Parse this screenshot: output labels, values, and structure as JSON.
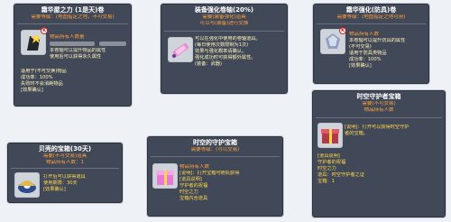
{
  "cards": [
    {
      "title": "霜华屋之力 (1是天)卷",
      "sub1": "需要等级：(地图指定之地，不可交易)",
      "sub2": "物品持有人数量",
      "lines": [
        "本卷轴可以提升物品的属性",
        "使用后可以获得永久属性",
        "适用于(不可交换)物品",
        "成功率：100%",
        "失败时不会消耗物品",
        "[效果确认]"
      ],
      "icon": "star-stone-icon",
      "badge": "K"
    },
    {
      "title": "装备强化卷轴(20%)",
      "sub1": "需要(装备强化)道具",
      "sub2": "可以与(装备)进行交换",
      "lines": [
        "可以在强化中使用的卷轴道具。",
        "(每日使用次数限制为1次)",
        "效果与强化概率请确认。",
        "强化成功时可获得额外属性。",
        "(装备：武器)"
      ],
      "icon": "scroll-icon"
    },
    {
      "title": "霜华强化(防具)卷",
      "sub1": "需要等级：(地图指定之地可用)",
      "sub2": "物品持有人数",
      "lines": [
        "本卷轴可以提升防具的属性",
        "(不可交易)",
        "适用于防具类物品",
        "成功率：100%",
        "[效果确认]"
      ],
      "icon": "crystal-armor-icon",
      "badge": "K"
    },
    {
      "title": "贝壳的宝箱(30天)",
      "sub1": "需要(不可交易)道具",
      "sub2": "物品持有人数：1",
      "lines": [
        "打开后可以获得道具",
        "使用期限：30天",
        "[效果确认]"
      ],
      "icon": "shell-pearl-icon"
    },
    {
      "title": "时空的守护宝箱",
      "sub1": "需要等级：(可以交易)",
      "sub2": "物品持有人数",
      "lines": [
        "[说明]：打开宝箱可随机获得",
        "",
        "[道具说明]",
        "守护者的祝福",
        "时空之力",
        "宝箱内含道具"
      ],
      "icon": "gift-box-icon"
    },
    {
      "title": "时空守护者宝箱",
      "sub1": "需要(不可交易)",
      "sub2": "物品持有人数",
      "lines": [
        "[说明]：打开可以获得时空守护",
        "者的宝箱。",
        "",
        "[道具说明]",
        "守护者的祝福",
        "时空之力",
        "道具：时空守护者之证",
        "宝箱：1"
      ],
      "icon": "red-box-icon"
    }
  ]
}
